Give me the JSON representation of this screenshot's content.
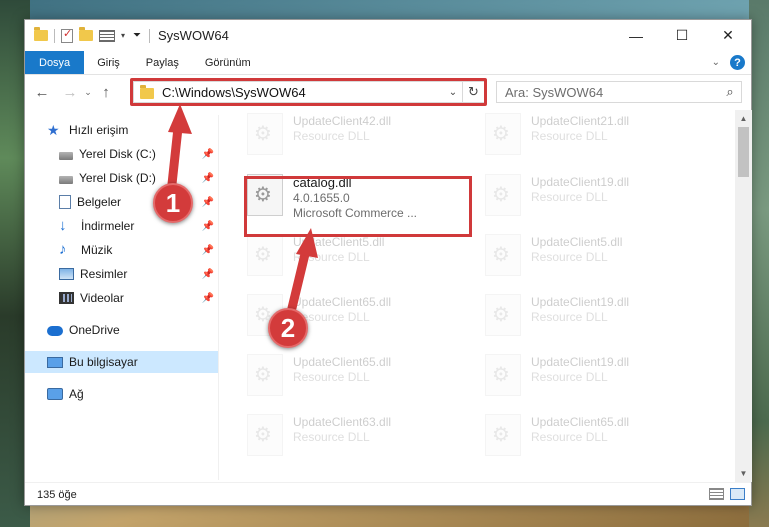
{
  "window": {
    "title": "SysWOW64",
    "controls": {
      "minimize": "—",
      "maximize": "☐",
      "close": "✕"
    }
  },
  "ribbon": {
    "tabs": [
      "Dosya",
      "Giriş",
      "Paylaş",
      "Görünüm"
    ],
    "accent_color": "#1979ca"
  },
  "address_bar": {
    "path": "C:\\Windows\\SysWOW64",
    "highlight_color": "#d0393a"
  },
  "search": {
    "placeholder": "Ara: SysWOW64"
  },
  "nav_pane": {
    "quick_access": "Hızlı erişim",
    "items": [
      {
        "label": "Yerel Disk (C:)",
        "icon": "disk-icon"
      },
      {
        "label": "Yerel Disk (D:)",
        "icon": "disk-icon"
      },
      {
        "label": "Belgeler",
        "icon": "documents-icon"
      },
      {
        "label": "İndirmeler",
        "icon": "downloads-icon"
      },
      {
        "label": "Müzik",
        "icon": "music-icon"
      },
      {
        "label": "Resimler",
        "icon": "pictures-icon"
      },
      {
        "label": "Videolar",
        "icon": "videos-icon"
      }
    ],
    "onedrive": "OneDrive",
    "this_pc": "Bu bilgisayar",
    "network": "Ağ"
  },
  "files": {
    "selected": {
      "name": "catalog.dll",
      "version": "4.0.1655.0",
      "description": "Microsoft Commerce ..."
    },
    "faded": [
      {
        "name": "UpdateClient42.dll",
        "type": "Resource DLL"
      },
      {
        "name": "UpdateClient21.dll",
        "type": "Resource DLL"
      },
      {
        "name": "UpdateClient19.dll",
        "type": "Resource DLL"
      },
      {
        "name": "UpdateClient5.dll",
        "type": "Resource DLL"
      },
      {
        "name": "UpdateClient5.dll",
        "type": "Resource DLL"
      },
      {
        "name": "UpdateClient65.dll",
        "type": "Resource DLL"
      },
      {
        "name": "UpdateClient19.dll",
        "type": "Resource DLL"
      },
      {
        "name": "UpdateClient65.dll",
        "type": "Resource DLL"
      },
      {
        "name": "UpdateClient19.dll",
        "type": "Resource DLL"
      },
      {
        "name": "UpdateClient63.dll",
        "type": "Resource DLL"
      },
      {
        "name": "UpdateClient65.dll",
        "type": "Resource DLL"
      }
    ]
  },
  "status": {
    "item_count": "135 öğe"
  },
  "annotations": {
    "step1": "1",
    "step2": "2",
    "color": "#d33b3b"
  }
}
